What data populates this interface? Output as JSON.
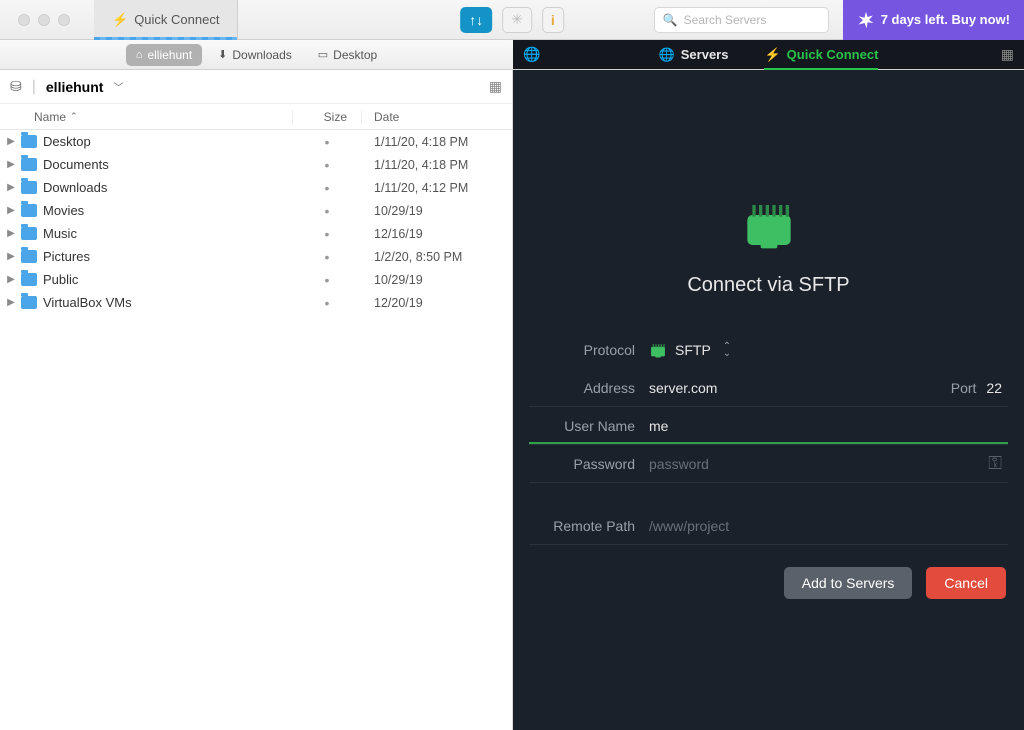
{
  "titlebar": {
    "tab_label": "Quick Connect",
    "search_placeholder": "Search Servers",
    "trial_text": "7 days left. Buy now!"
  },
  "breadcrumbs": [
    {
      "label": "elliehunt",
      "icon": "home",
      "active": true
    },
    {
      "label": "Downloads",
      "icon": "download",
      "active": false
    },
    {
      "label": "Desktop",
      "icon": "desktop",
      "active": false
    }
  ],
  "right_tabs": {
    "servers": "Servers",
    "quick_connect": "Quick Connect"
  },
  "location": {
    "name": "elliehunt"
  },
  "columns": {
    "name": "Name",
    "size": "Size",
    "date": "Date"
  },
  "files": [
    {
      "name": "Desktop",
      "size": "•",
      "date": "1/11/20, 4:18 PM"
    },
    {
      "name": "Documents",
      "size": "•",
      "date": "1/11/20, 4:18 PM"
    },
    {
      "name": "Downloads",
      "size": "•",
      "date": "1/11/20, 4:12 PM"
    },
    {
      "name": "Movies",
      "size": "•",
      "date": "10/29/19"
    },
    {
      "name": "Music",
      "size": "•",
      "date": "12/16/19"
    },
    {
      "name": "Pictures",
      "size": "•",
      "date": "1/2/20, 8:50 PM"
    },
    {
      "name": "Public",
      "size": "•",
      "date": "10/29/19"
    },
    {
      "name": "VirtualBox VMs",
      "size": "•",
      "date": "12/20/19"
    }
  ],
  "connect": {
    "title": "Connect via SFTP",
    "labels": {
      "protocol": "Protocol",
      "address": "Address",
      "port": "Port",
      "username": "User Name",
      "password": "Password",
      "remote_path": "Remote Path"
    },
    "values": {
      "protocol": "SFTP",
      "address": "server.com",
      "port": "22",
      "username": "me",
      "password_placeholder": "password",
      "remote_path_placeholder": "/www/project"
    },
    "buttons": {
      "add": "Add to Servers",
      "cancel": "Cancel"
    }
  }
}
